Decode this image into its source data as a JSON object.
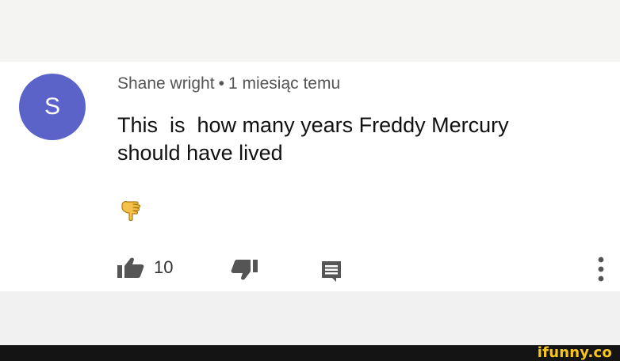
{
  "comment": {
    "avatar_letter": "S",
    "author": "Shane wright",
    "separator": "•",
    "time": "1 miesiąc temu",
    "text": "This  is  how many years Freddy Mercury\nshould have lived",
    "emoji": "backhand-index-pointing-down",
    "avatar_color": "#5b63c9"
  },
  "actions": {
    "like_icon": "thumbs-up-icon",
    "like_count": "10",
    "dislike_icon": "thumbs-down-icon",
    "reply_icon": "comment-icon",
    "more_icon": "more-vertical-icon"
  },
  "footer": {
    "watermark": "ifunny.co",
    "watermark_color": "#f6c61e"
  }
}
